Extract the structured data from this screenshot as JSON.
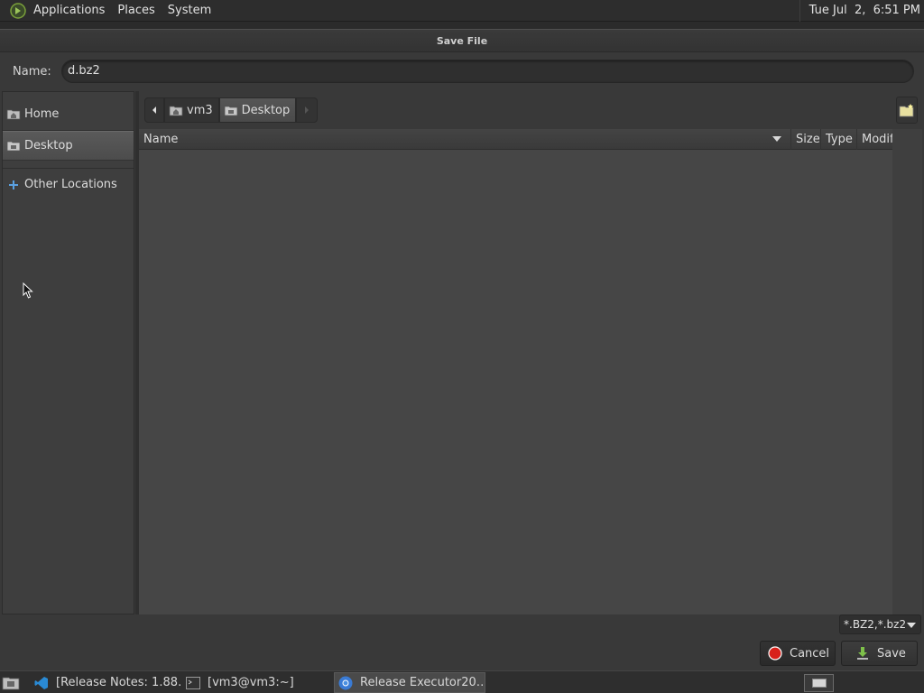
{
  "top_panel": {
    "menus": [
      "Applications",
      "Places",
      "System"
    ],
    "clock": "Tue Jul  2,  6:51 PM"
  },
  "dialog": {
    "title": "Save File",
    "name_label": "Name:",
    "name_value": "d.bz2",
    "sidebar": {
      "items": [
        {
          "label": "Home",
          "icon": "home-folder-icon"
        },
        {
          "label": "Desktop",
          "icon": "desktop-folder-icon",
          "active": true
        },
        {
          "label": "Other Locations",
          "icon": "plus-icon"
        }
      ]
    },
    "path": {
      "segments": [
        "vm3",
        "Desktop"
      ],
      "current": "Desktop"
    },
    "columns": [
      "Name",
      "Size",
      "Type",
      "Modif"
    ],
    "filter": "*.BZ2,*.bz2",
    "buttons": {
      "cancel": "Cancel",
      "save": "Save"
    }
  },
  "taskbar": {
    "tasks": [
      {
        "label": "[Release Notes: 1.88…",
        "icon": "vscode-icon"
      },
      {
        "label": "[vm3@vm3:~]",
        "icon": "terminal-icon"
      },
      {
        "label": "Release Executor20…",
        "icon": "chrome-icon",
        "active": true
      }
    ]
  },
  "colors": {
    "background": "#393939",
    "panel": "#2d2d2d",
    "accent_red": "#d8201a"
  }
}
